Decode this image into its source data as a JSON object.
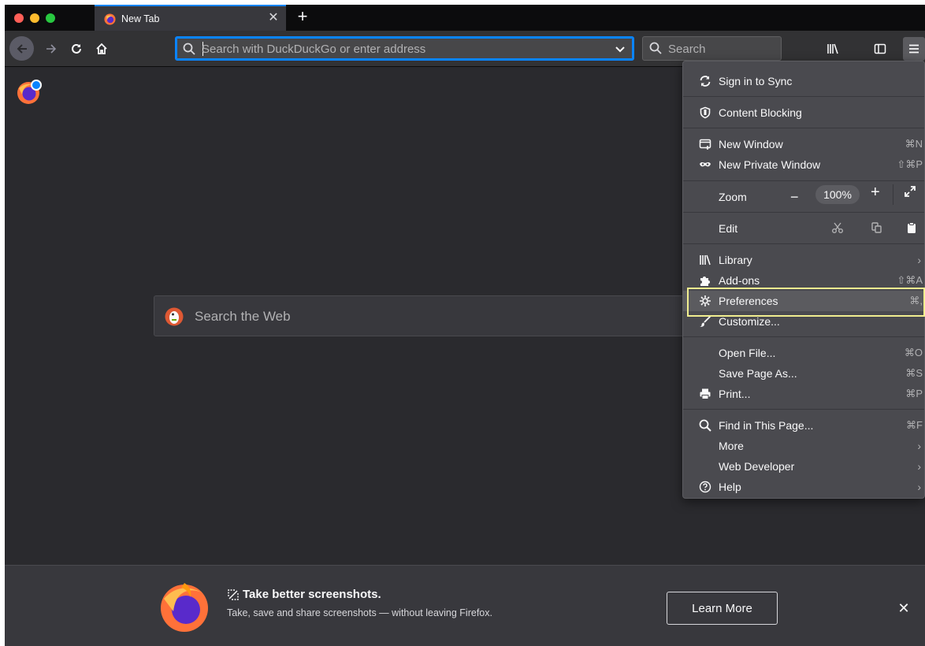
{
  "tabs": [
    {
      "title": "New Tab"
    }
  ],
  "toolbar": {
    "url_placeholder": "Search with DuckDuckGo or enter address",
    "search_placeholder": "Search"
  },
  "content": {
    "web_search_placeholder": "Search the Web"
  },
  "snippet": {
    "title": "Take better screenshots.",
    "text": "Take, save and share screenshots — without leaving Firefox.",
    "button": "Learn More"
  },
  "menu": {
    "sync": "Sign in to Sync",
    "content_blocking": "Content Blocking",
    "new_window": {
      "label": "New Window",
      "shortcut": "⌘N"
    },
    "new_private_window": {
      "label": "New Private Window",
      "shortcut": "⇧⌘P"
    },
    "zoom": {
      "label": "Zoom",
      "value": "100%"
    },
    "edit": "Edit",
    "library": "Library",
    "addons": {
      "label": "Add-ons",
      "shortcut": "⇧⌘A"
    },
    "preferences": {
      "label": "Preferences",
      "shortcut": "⌘,"
    },
    "customize": "Customize...",
    "open_file": {
      "label": "Open File...",
      "shortcut": "⌘O"
    },
    "save_page": {
      "label": "Save Page As...",
      "shortcut": "⌘S"
    },
    "print": {
      "label": "Print...",
      "shortcut": "⌘P"
    },
    "find": {
      "label": "Find in This Page...",
      "shortcut": "⌘F"
    },
    "more": "More",
    "web_developer": "Web Developer",
    "help": "Help"
  },
  "colors": {
    "accent": "#0a84ff",
    "highlight_outline": "#f1ee8f"
  }
}
